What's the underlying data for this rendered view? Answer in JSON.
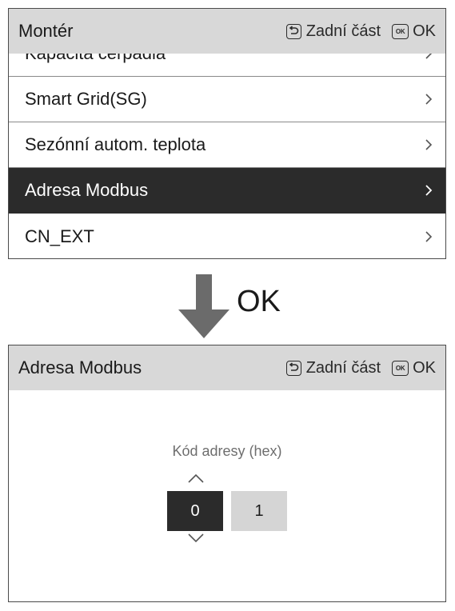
{
  "top_screen": {
    "title": "Montér",
    "back_label": "Zadní část",
    "ok_badge": "OK",
    "ok_label": "OK",
    "menu_items": [
      {
        "label": "Kapacita čerpadla",
        "selected": false
      },
      {
        "label": "Smart Grid(SG)",
        "selected": false
      },
      {
        "label": "Sezónní autom. teplota",
        "selected": false
      },
      {
        "label": "Adresa Modbus",
        "selected": true
      },
      {
        "label": "CN_EXT",
        "selected": false
      }
    ]
  },
  "transition": {
    "label": "OK"
  },
  "bottom_screen": {
    "title": "Adresa Modbus",
    "back_label": "Zadní část",
    "ok_badge": "OK",
    "ok_label": "OK",
    "field_label": "Kód adresy (hex)",
    "digits": [
      "0",
      "1"
    ],
    "active_digit_index": 0
  },
  "colors": {
    "header_bg": "#d8d8d8",
    "selected_bg": "#2b2b2b",
    "inactive_digit_bg": "#d5d5d5",
    "arrow": "#6b6b6b"
  }
}
